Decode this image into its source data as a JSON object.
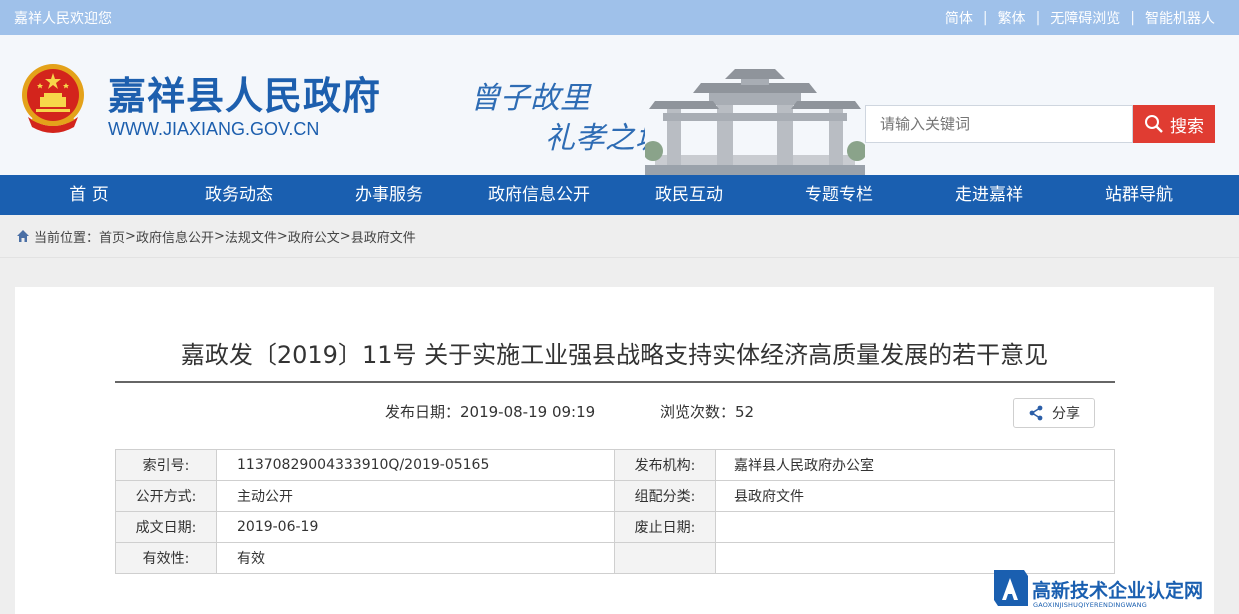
{
  "topbar": {
    "welcome": "嘉祥人民欢迎您",
    "links": [
      "简体",
      "繁体",
      "无障碍浏览",
      "智能机器人"
    ]
  },
  "header": {
    "site_name": "嘉祥县人民政府",
    "site_url": "WWW.JIAXIANG.GOV.CN",
    "slogan_line1": "曾子故里",
    "slogan_line2": "礼孝之城",
    "search_placeholder": "请输入关键词",
    "search_button": "搜索"
  },
  "nav": [
    "首 页",
    "政务动态",
    "办事服务",
    "政府信息公开",
    "政民互动",
    "专题专栏",
    "走进嘉祥",
    "站群导航"
  ],
  "breadcrumb": {
    "label": "当前位置：",
    "items": [
      "首页",
      "政府信息公开",
      "法规文件",
      "政府公文",
      "县政府文件"
    ],
    "separator": ">"
  },
  "article": {
    "title": "嘉政发〔2019〕11号 关于实施工业强县战略支持实体经济高质量发展的若干意见",
    "publish_date": "发布日期：2019-08-19 09:19",
    "views": "浏览次数：52",
    "share_label": "分享"
  },
  "info_table": [
    [
      "索引号:",
      "11370829004333910Q/2019-05165",
      "发布机构:",
      "嘉祥县人民政府办公室"
    ],
    [
      "公开方式:",
      "主动公开",
      "组配分类:",
      "县政府文件"
    ],
    [
      "成文日期:",
      "2019-06-19",
      "废止日期:",
      ""
    ],
    [
      "有效性:",
      "有效",
      "",
      ""
    ]
  ],
  "watermark": {
    "title": "高新技术企业认定网",
    "subtitle": "GAOXINJISHUQIYERENDINGWANG"
  },
  "colors": {
    "brand_blue": "#1a5fb0",
    "topbar_blue": "#9fc1ea",
    "search_red": "#e03c32"
  }
}
